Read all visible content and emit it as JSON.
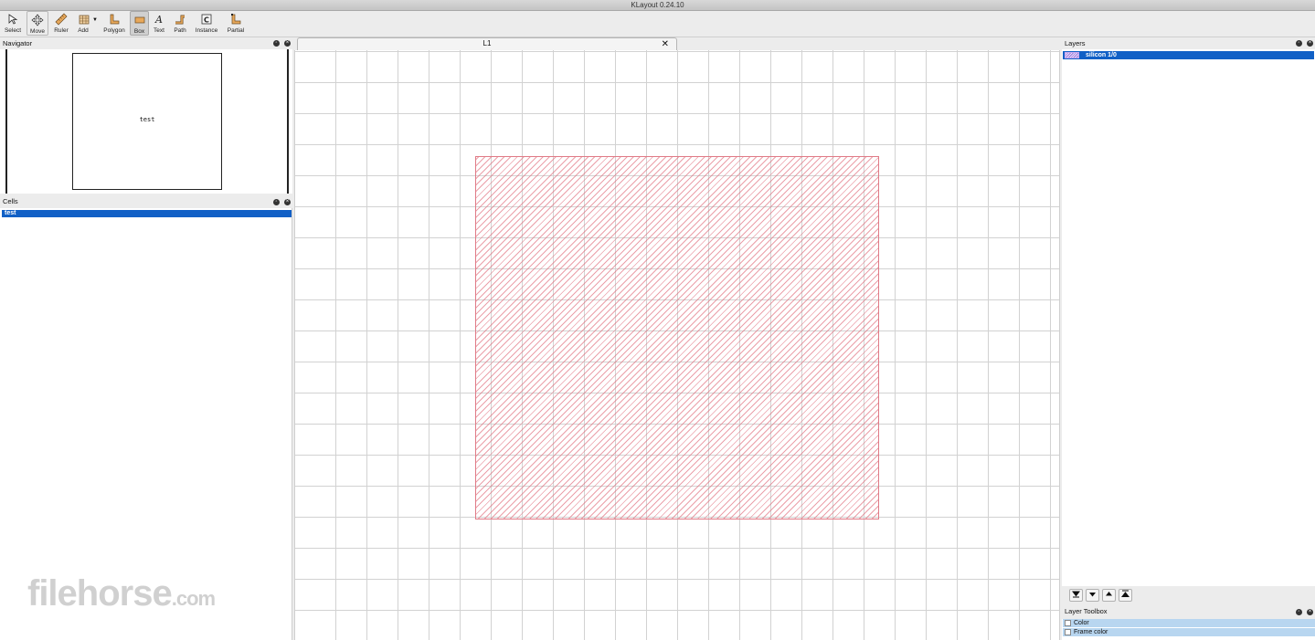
{
  "window": {
    "title": "KLayout 0.24.10"
  },
  "toolbar": {
    "tools": [
      {
        "label": "Select",
        "icon": "select-arrow-icon"
      },
      {
        "label": "Move",
        "icon": "move-cross-icon"
      },
      {
        "label": "Ruler",
        "icon": "ruler-icon"
      },
      {
        "label": "Add",
        "icon": "add-grid-icon"
      },
      {
        "label": "Polygon",
        "icon": "polygon-icon"
      },
      {
        "label": "Box",
        "icon": "box-icon"
      },
      {
        "label": "Text",
        "icon": "text-icon"
      },
      {
        "label": "Path",
        "icon": "path-icon"
      },
      {
        "label": "Instance",
        "icon": "instance-icon"
      },
      {
        "label": "Partial",
        "icon": "partial-icon"
      }
    ],
    "active_tool": "Box"
  },
  "navigator": {
    "title": "Navigator",
    "cell_label": "test"
  },
  "cells": {
    "title": "Cells",
    "items": [
      "test"
    ]
  },
  "layout_tab": {
    "label": "L1",
    "close_glyph": "✕"
  },
  "layers": {
    "title": "Layers",
    "items": [
      {
        "name": "silicon 1/0",
        "fill_color": "#9b7bd6"
      }
    ],
    "actions": [
      "move-to-bottom-icon",
      "move-down-icon",
      "move-up-icon",
      "move-to-top-icon"
    ]
  },
  "layer_toolbox": {
    "title": "Layer Toolbox",
    "items": [
      "Color",
      "Frame color"
    ]
  },
  "watermark": {
    "brand": "filehorse",
    "domain": ".com"
  },
  "colors": {
    "selection": "#1160c6",
    "shape_outline": "#e07a86",
    "toolbox_row": "#b8d6f0"
  }
}
